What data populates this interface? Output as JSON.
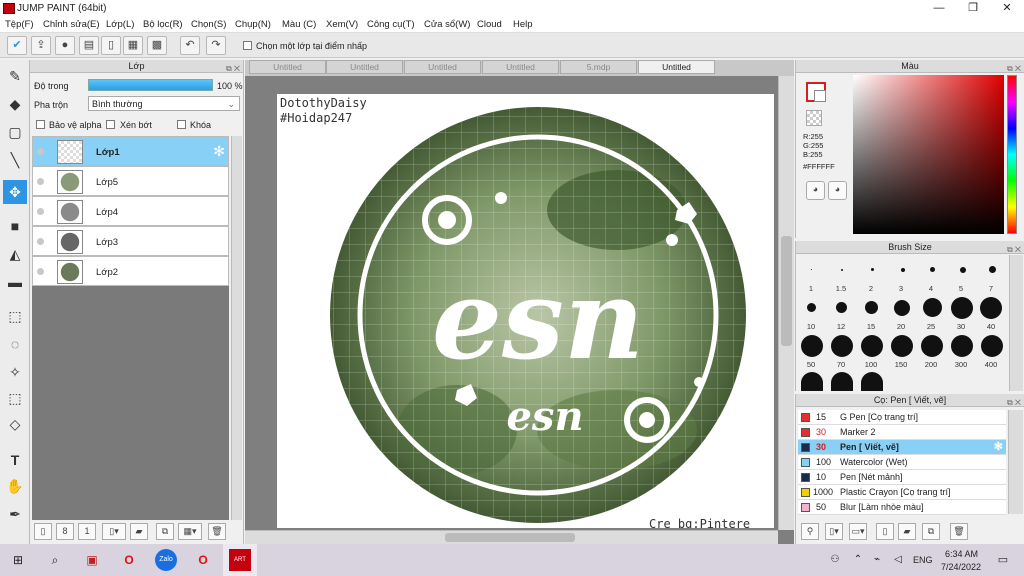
{
  "window": {
    "title": "JUMP PAINT (64bit)",
    "min": "—",
    "max": "❐",
    "close": "✕"
  },
  "menu": [
    "Tệp(F)",
    "Chỉnh sửa(E)",
    "Lớp(L)",
    "Bộ lọc(R)",
    "Chọn(S)",
    "Chụp(N)",
    "Màu (C)",
    "Xem(V)",
    "Công cụ(T)",
    "Cửa sổ(W)",
    "Cloud",
    "Help"
  ],
  "toolbar": {
    "checkbox_label": "Chọn một lớp tại điểm nhấp"
  },
  "layer_panel": {
    "title": "Lớp",
    "opacity_label": "Độ trong",
    "opacity_value": "100 %",
    "blend_label": "Pha trộn",
    "blend_value": "Bình thường",
    "protect_alpha": "Bảo vệ alpha",
    "clip": "Xén bớt",
    "lock": "Khóa",
    "layers": [
      {
        "name": "Lớp1",
        "active": true
      },
      {
        "name": "Lớp5",
        "active": false
      },
      {
        "name": "Lớp4",
        "active": false
      },
      {
        "name": "Lớp3",
        "active": false
      },
      {
        "name": "Lớp2",
        "active": false
      }
    ]
  },
  "tabs": [
    "Untitled",
    "Untitled",
    "Untitled",
    "Untitled",
    "5.mdp",
    "Untitled"
  ],
  "canvas": {
    "text1": "DotothyDaisy",
    "text2": "#Hoidap247",
    "credit": "Cre bg:Pintere",
    "logo_big": "esn",
    "logo_small": "esn"
  },
  "color_panel": {
    "title": "Màu",
    "r": "R:255",
    "g": "G:255",
    "b": "B:255",
    "hex": "#FFFFFF"
  },
  "brush_panel": {
    "title": "Brush Size",
    "sizes": [
      "1",
      "1.5",
      "2",
      "3",
      "4",
      "5",
      "7",
      "10",
      "12",
      "15",
      "20",
      "25",
      "30",
      "40",
      "50",
      "70",
      "100",
      "150",
      "200",
      "300",
      "400"
    ]
  },
  "tool_panel": {
    "title": "Cọ: Pen [ Viết, vẽ]",
    "items": [
      {
        "size": "15",
        "name": "G Pen [Cọ trang trí]",
        "color": "#e03030"
      },
      {
        "size": "30",
        "name": "Marker 2",
        "color": "#e03030"
      },
      {
        "size": "30",
        "name": "Pen [ Viết, vẽ]",
        "color": "#1a2a4a"
      },
      {
        "size": "100",
        "name": "Watercolor (Wet)",
        "color": "#7fd4f5"
      },
      {
        "size": "10",
        "name": "Pen [Nét mảnh]",
        "color": "#1a2a4a"
      },
      {
        "size": "1000",
        "name": "Plastic Crayon [Cọ trang trí]",
        "color": "#f0d000"
      },
      {
        "size": "50",
        "name": "Blur [Làm nhòe màu]",
        "color": "#f5b0d0"
      }
    ]
  },
  "taskbar": {
    "time": "6:34 AM",
    "date": "7/24/2022",
    "lang": "ENG"
  }
}
